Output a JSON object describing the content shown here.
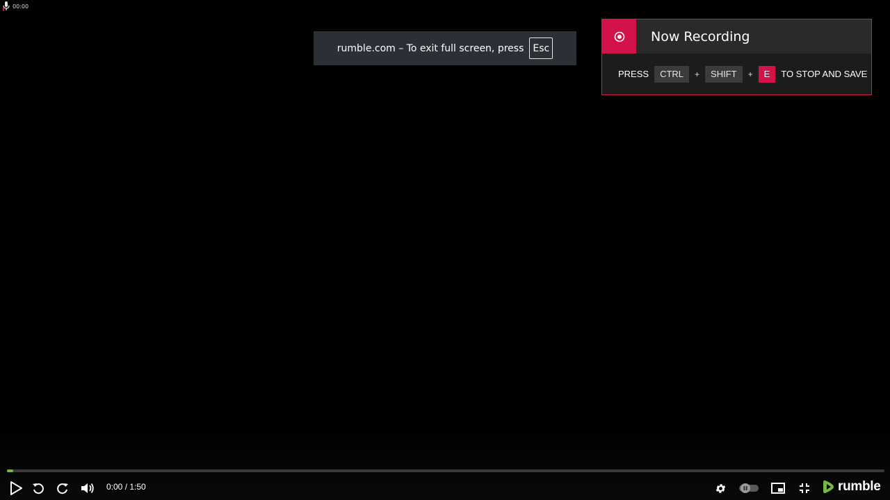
{
  "recording_indicator": {
    "timer": "00:00",
    "icon": "microphone-icon"
  },
  "fullscreen_notice": {
    "text": "rumble.com – To exit full screen, press",
    "key": "Esc"
  },
  "recording_panel": {
    "title": "Now Recording",
    "icon": "record-icon",
    "instruction_prefix": "PRESS",
    "keys": [
      "CTRL",
      "SHIFT",
      "E"
    ],
    "plus": "+",
    "instruction_suffix": "TO STOP AND SAVE",
    "accent_color": "#d3124a"
  },
  "player": {
    "time": "0:00 / 1:50",
    "progress_fraction": 0.007,
    "controls": {
      "play": "play-icon",
      "replay": "rewind-icon",
      "forward": "forward-icon",
      "volume": "volume-icon",
      "settings": "gear-icon",
      "autoplay": "autoplay-toggle-icon",
      "pip": "picture-in-picture-icon",
      "exit_fullscreen": "exit-fullscreen-icon"
    },
    "brand": "rumble",
    "brand_color": "#74b84a"
  }
}
